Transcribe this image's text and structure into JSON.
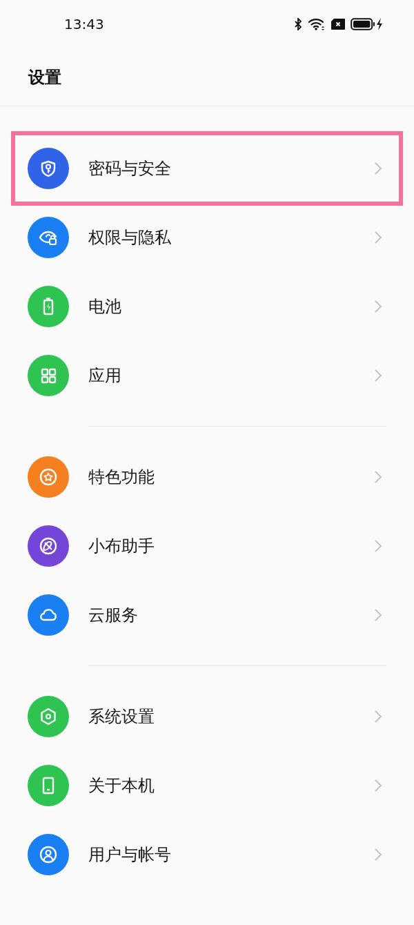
{
  "status_bar": {
    "time": "13:43"
  },
  "header": {
    "title": "设置"
  },
  "sections": [
    {
      "items": [
        {
          "label": "密码与安全",
          "color": "#2f63e8",
          "highlighted": true
        },
        {
          "label": "权限与隐私",
          "color": "#1a7ff2",
          "highlighted": false
        },
        {
          "label": "电池",
          "color": "#2fc352",
          "highlighted": false
        },
        {
          "label": "应用",
          "color": "#2fc352",
          "highlighted": false
        }
      ]
    },
    {
      "items": [
        {
          "label": "特色功能",
          "color": "#f5801f",
          "highlighted": false
        },
        {
          "label": "小布助手",
          "color": "#7545d9",
          "highlighted": false
        },
        {
          "label": "云服务",
          "color": "#1a7ff2",
          "highlighted": false
        }
      ]
    },
    {
      "items": [
        {
          "label": "系统设置",
          "color": "#2fc352",
          "highlighted": false
        },
        {
          "label": "关于本机",
          "color": "#2fc352",
          "highlighted": false
        },
        {
          "label": "用户与帐号",
          "color": "#1a7ff2",
          "highlighted": false
        }
      ]
    }
  ]
}
